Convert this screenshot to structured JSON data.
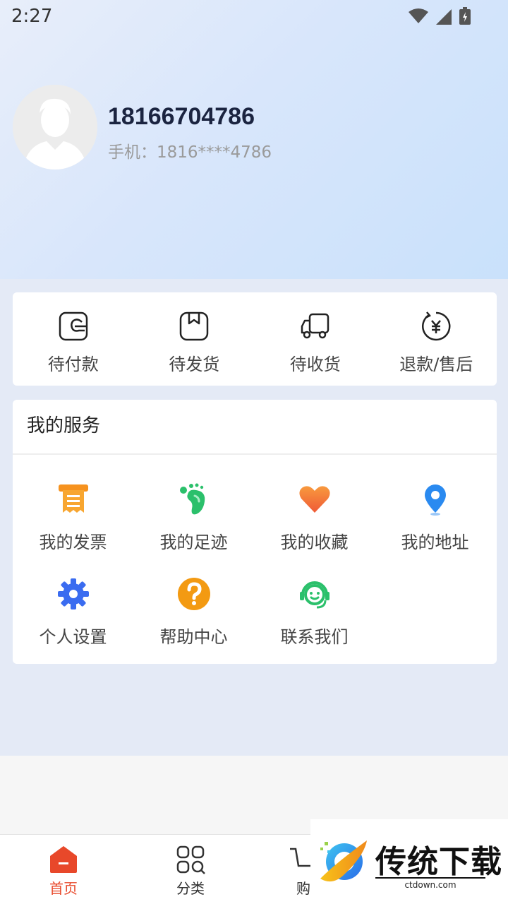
{
  "status_bar": {
    "time": "2:27"
  },
  "profile": {
    "username": "18166704786",
    "phone": "手机：1816****4786"
  },
  "orders": [
    {
      "label": "待付款",
      "icon": "wallet-icon"
    },
    {
      "label": "待发货",
      "icon": "package-icon"
    },
    {
      "label": "待收货",
      "icon": "truck-icon"
    },
    {
      "label": "退款/售后",
      "icon": "refund-icon"
    }
  ],
  "services": {
    "title": "我的服务",
    "items": [
      {
        "label": "我的发票",
        "icon": "invoice-icon",
        "color": "#f6921e"
      },
      {
        "label": "我的足迹",
        "icon": "footprint-icon",
        "color": "#2bc06b"
      },
      {
        "label": "我的收藏",
        "icon": "heart-icon",
        "color": "#f26a3a"
      },
      {
        "label": "我的地址",
        "icon": "location-icon",
        "color": "#2a8af0"
      },
      {
        "label": "个人设置",
        "icon": "gear-icon",
        "color": "#3a6cf0"
      },
      {
        "label": "帮助中心",
        "icon": "help-icon",
        "color": "#f39a12"
      },
      {
        "label": "联系我们",
        "icon": "customer-service-icon",
        "color": "#2bc06b"
      }
    ]
  },
  "tabbar": {
    "tabs": [
      {
        "label": "首页",
        "icon": "home-icon"
      },
      {
        "label": "分类",
        "icon": "category-icon"
      },
      {
        "label": "购",
        "icon": "cart-icon"
      }
    ],
    "accent": "#e8482a"
  },
  "watermark": {
    "text": "传统下载",
    "sub": "ctdown.com"
  }
}
